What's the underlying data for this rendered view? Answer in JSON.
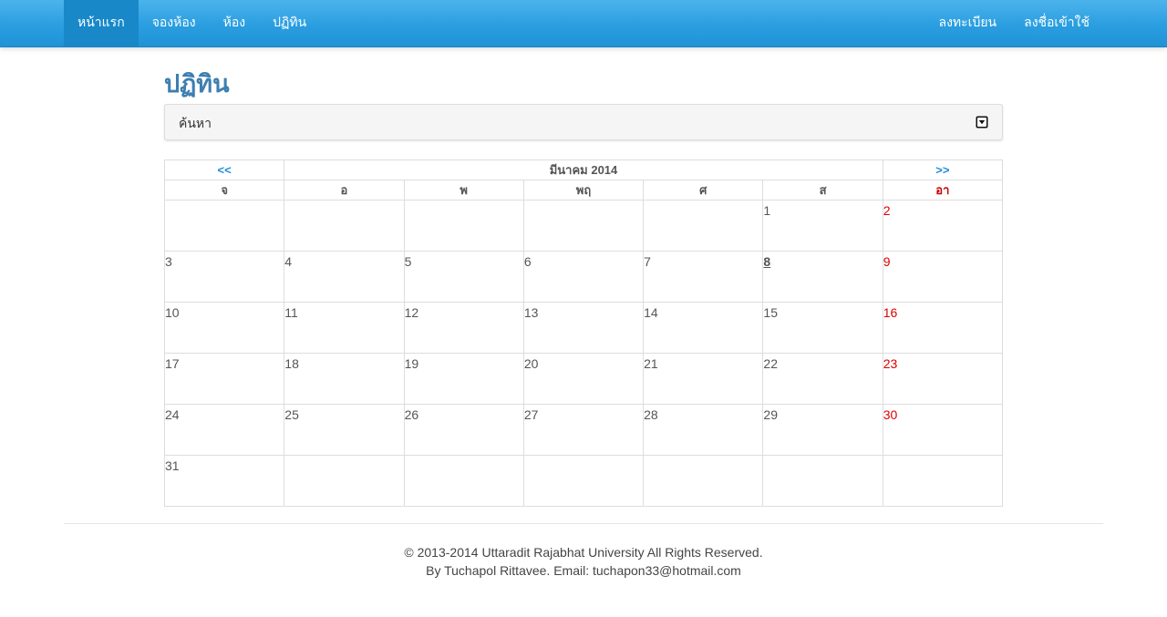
{
  "navbar": {
    "left_items": [
      {
        "label": "หน้าแรก",
        "active": true
      },
      {
        "label": "จองห้อง",
        "active": false
      },
      {
        "label": "ห้อง",
        "active": false
      },
      {
        "label": "ปฏิทิน",
        "active": false
      }
    ],
    "right_items": [
      {
        "label": "ลงทะเบียน"
      },
      {
        "label": "ลงชื่อเข้าใช้"
      }
    ],
    "colors": {
      "bar": "#2a9ee0",
      "active_item": "#1888c8"
    }
  },
  "page": {
    "title": "ปฏิทิน"
  },
  "search_panel": {
    "label": "ค้นหา",
    "toggle_icon": "caret-square-down-icon"
  },
  "calendar": {
    "prev_label": "<<",
    "next_label": ">>",
    "month_label": "มีนาคม 2014",
    "weekdays": [
      "จ",
      "อ",
      "พ",
      "พฤ",
      "ศ",
      "ส",
      "อา"
    ],
    "weekend_color": "#dd0000",
    "today": "8",
    "weeks": [
      [
        "",
        "",
        "",
        "",
        "",
        "1",
        "2"
      ],
      [
        "3",
        "4",
        "5",
        "6",
        "7",
        "8",
        "9"
      ],
      [
        "10",
        "11",
        "12",
        "13",
        "14",
        "15",
        "16"
      ],
      [
        "17",
        "18",
        "19",
        "20",
        "21",
        "22",
        "23"
      ],
      [
        "24",
        "25",
        "26",
        "27",
        "28",
        "29",
        "30"
      ],
      [
        "31",
        "",
        "",
        "",
        "",
        "",
        ""
      ]
    ]
  },
  "footer": {
    "line1": "© 2013-2014 Uttaradit Rajabhat University All Rights Reserved.",
    "line2": "By Tuchapol Rittavee. Email: tuchapon33@hotmail.com"
  }
}
